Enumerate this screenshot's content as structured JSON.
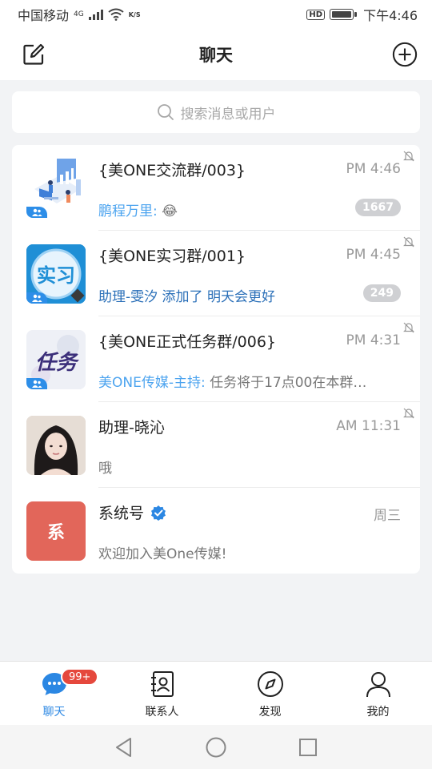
{
  "status_bar": {
    "carrier": "中国移动",
    "network": "4G",
    "data_speed": "K/S",
    "hd": "HD",
    "time": "下午4:46"
  },
  "header": {
    "title": "聊天"
  },
  "search": {
    "placeholder": "搜索消息或用户"
  },
  "chats": [
    {
      "name": "{美ONE交流群/003}",
      "time": "PM 4:46",
      "sender": "鹏程万里:",
      "message": "😂",
      "badge": "1667",
      "is_group": true,
      "muted": true
    },
    {
      "name": "{美ONE实习群/001}",
      "time": "PM 4:45",
      "sender": "",
      "message": "助理-雯汐 添加了 明天会更好",
      "badge": "249",
      "is_group": true,
      "muted": true,
      "avatar_text": "实习"
    },
    {
      "name": "{美ONE正式任务群/006}",
      "time": "PM 4:31",
      "sender": "美ONE传媒-主持:",
      "message": "任务将于17点00在本群…",
      "badge": "",
      "is_group": true,
      "muted": true,
      "avatar_text": "任务"
    },
    {
      "name": "助理-晓沁",
      "time": "AM 11:31",
      "sender": "",
      "message": "哦",
      "badge": "",
      "is_group": false,
      "muted": true
    },
    {
      "name": "系统号",
      "time": "周三",
      "sender": "",
      "message": "欢迎加入美One传媒!",
      "badge": "",
      "is_group": false,
      "muted": false,
      "verified": true,
      "avatar_text": "系"
    }
  ],
  "bottom_nav": {
    "items": [
      {
        "label": "聊天",
        "icon": "chat-bubble-icon",
        "active": true,
        "badge": "99+"
      },
      {
        "label": "联系人",
        "icon": "contacts-icon",
        "active": false
      },
      {
        "label": "发现",
        "icon": "compass-icon",
        "active": false
      },
      {
        "label": "我的",
        "icon": "person-icon",
        "active": false
      }
    ]
  },
  "colors": {
    "accent": "#2b87e3",
    "badge_red": "#e5483d",
    "system_avatar": "#e2665a"
  }
}
